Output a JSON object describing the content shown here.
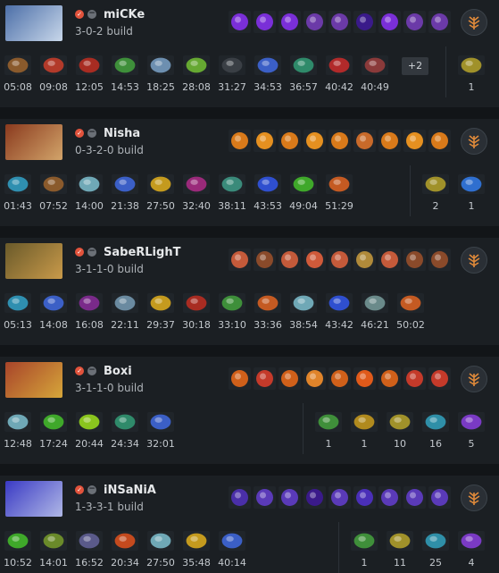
{
  "players": [
    {
      "name": "miCKe",
      "build": "3-0-2 build",
      "hero_icon": "luna-icon",
      "portrait_colors": [
        "#4c6fa8",
        "#c8d7ea"
      ],
      "abilities": [
        "lucent-beam",
        "lucent-beam",
        "lucent-beam",
        "moon-glaive",
        "moon-glaive",
        "eclipse",
        "lucent-beam",
        "moon-glaive",
        "moon-glaive"
      ],
      "ability_colors": [
        "#7a2fd8",
        "#7a2fd8",
        "#7a2fd8",
        "#6b3aa8",
        "#6b3aa8",
        "#3a1a8a",
        "#7a2fd8",
        "#6b3aa8",
        "#6b3aa8"
      ],
      "items": [
        {
          "icon": "boots-icon",
          "time": "05:08",
          "color": "#8a5a2c"
        },
        {
          "icon": "power-treads-icon",
          "time": "09:08",
          "color": "#b23a2a"
        },
        {
          "icon": "armlet-icon",
          "time": "12:05",
          "color": "#a82c22"
        },
        {
          "icon": "lance-icon",
          "time": "14:53",
          "color": "#3e8f3a"
        },
        {
          "icon": "mask-icon",
          "time": "18:25",
          "color": "#6d8fb0"
        },
        {
          "icon": "butterfly-icon",
          "time": "28:08",
          "color": "#66a832"
        },
        {
          "icon": "daedalus-icon",
          "time": "31:27",
          "color": "#3a3f45"
        },
        {
          "icon": "skadi-icon",
          "time": "34:53",
          "color": "#3b5fc6"
        },
        {
          "icon": "blade-icon",
          "time": "36:57",
          "color": "#2f8a6a"
        },
        {
          "icon": "satanic-icon",
          "time": "40:42",
          "color": "#b12a2a"
        },
        {
          "icon": "rapier-icon",
          "time": "40:49",
          "color": "#8a3a3a"
        }
      ],
      "more": "+2",
      "neutrals": [
        {
          "icon": "neutral-gold-icon",
          "count": "1",
          "color": "#a0912a"
        }
      ]
    },
    {
      "name": "Nisha",
      "build": "0-3-2-0 build",
      "hero_icon": "earthshaker-icon",
      "portrait_colors": [
        "#8a3a1e",
        "#d2a46a"
      ],
      "abilities": [
        "fissure",
        "fissure",
        "fissure",
        "fissure",
        "fissure",
        "enchant-totem",
        "fissure",
        "fissure",
        "fissure"
      ],
      "ability_colors": [
        "#d97a1a",
        "#e59020",
        "#d97a1a",
        "#e59020",
        "#d97a1a",
        "#c86a2a",
        "#d97a1a",
        "#e59020",
        "#d97a1a"
      ],
      "items": [
        {
          "icon": "bottle-icon",
          "time": "01:43",
          "color": "#2f8fb0"
        },
        {
          "icon": "boots-icon",
          "time": "07:52",
          "color": "#8a5a2c"
        },
        {
          "icon": "axe-icon",
          "time": "14:00",
          "color": "#6fa8b6"
        },
        {
          "icon": "dagon-icon",
          "time": "21:38",
          "color": "#3b5fc6"
        },
        {
          "icon": "claw-icon",
          "time": "27:50",
          "color": "#c49a1e"
        },
        {
          "icon": "orb-icon",
          "time": "32:40",
          "color": "#9a2a7a"
        },
        {
          "icon": "cuirass-icon",
          "time": "38:11",
          "color": "#3a8a7a"
        },
        {
          "icon": "wand-icon",
          "time": "43:53",
          "color": "#2f4fcf"
        },
        {
          "icon": "aura-icon",
          "time": "49:04",
          "color": "#3fa82a"
        },
        {
          "icon": "slipper-icon",
          "time": "51:29",
          "color": "#c45a22"
        }
      ],
      "neutrals": [
        {
          "icon": "neutral-gold-icon",
          "count": "2",
          "color": "#a0912a"
        },
        {
          "icon": "neutral-blue-icon",
          "count": "1",
          "color": "#2f6fcf"
        }
      ]
    },
    {
      "name": "SabeRLighT",
      "build": "3-1-1-0 build",
      "hero_icon": "beastmaster-icon",
      "portrait_colors": [
        "#6a5a2a",
        "#c99a4a"
      ],
      "abilities": [
        "wild-axes",
        "call-of-wild",
        "wild-axes",
        "inner-beast",
        "wild-axes",
        "primal-roar",
        "wild-axes",
        "call-of-wild",
        "call-of-wild"
      ],
      "ability_colors": [
        "#c45a3a",
        "#8a4a2a",
        "#c45a3a",
        "#d05a3a",
        "#c45a3a",
        "#b08a3a",
        "#c45a3a",
        "#8a4a2a",
        "#8a4a2a"
      ],
      "items": [
        {
          "icon": "bottle-icon",
          "time": "05:13",
          "color": "#2f8fb0"
        },
        {
          "icon": "dagon-icon",
          "time": "14:08",
          "color": "#3b5fc6"
        },
        {
          "icon": "sabre-icon",
          "time": "16:08",
          "color": "#7a2a8a"
        },
        {
          "icon": "helm-icon",
          "time": "22:11",
          "color": "#6a8aa0"
        },
        {
          "icon": "claw-icon",
          "time": "29:37",
          "color": "#c49a1e"
        },
        {
          "icon": "armlet-icon",
          "time": "30:18",
          "color": "#a82c22"
        },
        {
          "icon": "lance-icon",
          "time": "33:10",
          "color": "#3e8f3a"
        },
        {
          "icon": "crossed-icon",
          "time": "33:36",
          "color": "#c45a22"
        },
        {
          "icon": "axe-icon",
          "time": "38:54",
          "color": "#6fa8b6"
        },
        {
          "icon": "wand-icon",
          "time": "43:42",
          "color": "#2f4fcf"
        },
        {
          "icon": "spear-icon",
          "time": "46:21",
          "color": "#6a8a8a"
        },
        {
          "icon": "slipper-icon",
          "time": "50:02",
          "color": "#c45a22"
        }
      ],
      "neutrals": []
    },
    {
      "name": "Boxi",
      "build": "3-1-1-0 build",
      "hero_icon": "tusk-icon",
      "portrait_colors": [
        "#a8442a",
        "#d6a63a"
      ],
      "abilities": [
        "ice-shards",
        "snowball",
        "ice-shards",
        "tag-team",
        "ice-shards",
        "walrus-punch",
        "ice-shards",
        "snowball",
        "snowball"
      ],
      "ability_colors": [
        "#d0601a",
        "#c43a2a",
        "#d0601a",
        "#e0842a",
        "#d0601a",
        "#e05a1a",
        "#d0601a",
        "#c43a2a",
        "#c43a2a"
      ],
      "items": [
        {
          "icon": "axe-icon",
          "time": "12:48",
          "color": "#6fa8b6"
        },
        {
          "icon": "boots-green-icon",
          "time": "17:24",
          "color": "#3fa82a"
        },
        {
          "icon": "orb-green-icon",
          "time": "20:44",
          "color": "#8ac41e"
        },
        {
          "icon": "blade-icon",
          "time": "24:34",
          "color": "#2f8a6a"
        },
        {
          "icon": "dagon-icon",
          "time": "32:01",
          "color": "#3b5fc6"
        }
      ],
      "neutrals": [
        {
          "icon": "neutral-green-icon",
          "count": "1",
          "color": "#3f8f3a"
        },
        {
          "icon": "neutral-horn-icon",
          "count": "1",
          "color": "#b08a1e"
        },
        {
          "icon": "neutral-gold-icon",
          "count": "10",
          "color": "#a0912a"
        },
        {
          "icon": "neutral-teal-icon",
          "count": "16",
          "color": "#2f8fa8"
        },
        {
          "icon": "neutral-purple-icon",
          "count": "5",
          "color": "#7a3ac4"
        }
      ]
    },
    {
      "name": "iNSaNiA",
      "build": "1-3-3-1 build",
      "hero_icon": "void-spirit-icon",
      "portrait_colors": [
        "#3a3ac4",
        "#b0b8e6"
      ],
      "abilities": [
        "aether-remnant",
        "dissimilate",
        "dissimilate",
        "resonant-pulse",
        "dissimilate",
        "astral-step",
        "dissimilate",
        "dissimilate",
        "dissimilate"
      ],
      "ability_colors": [
        "#4a2fa8",
        "#5a3ab8",
        "#5a3ab8",
        "#3a1a8a",
        "#5a3ab8",
        "#4a2fb8",
        "#5a3ab8",
        "#5a3ab8",
        "#5a3ab8"
      ],
      "items": [
        {
          "icon": "boots-green-icon",
          "time": "10:52",
          "color": "#3fa82a"
        },
        {
          "icon": "cloak-icon",
          "time": "14:01",
          "color": "#6a8a2a"
        },
        {
          "icon": "shard-icon",
          "time": "16:52",
          "color": "#5a5a8a"
        },
        {
          "icon": "armlet-icon",
          "time": "20:34",
          "color": "#c44a1e"
        },
        {
          "icon": "axe-icon",
          "time": "27:50",
          "color": "#6fa8b6"
        },
        {
          "icon": "claw-icon",
          "time": "35:48",
          "color": "#c49a1e"
        },
        {
          "icon": "gauntlet-icon",
          "time": "40:14",
          "color": "#3b5fc6"
        }
      ],
      "neutrals": [
        {
          "icon": "neutral-green-icon",
          "count": "1",
          "color": "#3f8f3a"
        },
        {
          "icon": "neutral-gold-icon",
          "count": "11",
          "color": "#a0912a"
        },
        {
          "icon": "neutral-teal-icon",
          "count": "25",
          "color": "#2f8fa8"
        },
        {
          "icon": "neutral-purple-icon",
          "count": "4",
          "color": "#7a3ac4"
        }
      ]
    }
  ]
}
